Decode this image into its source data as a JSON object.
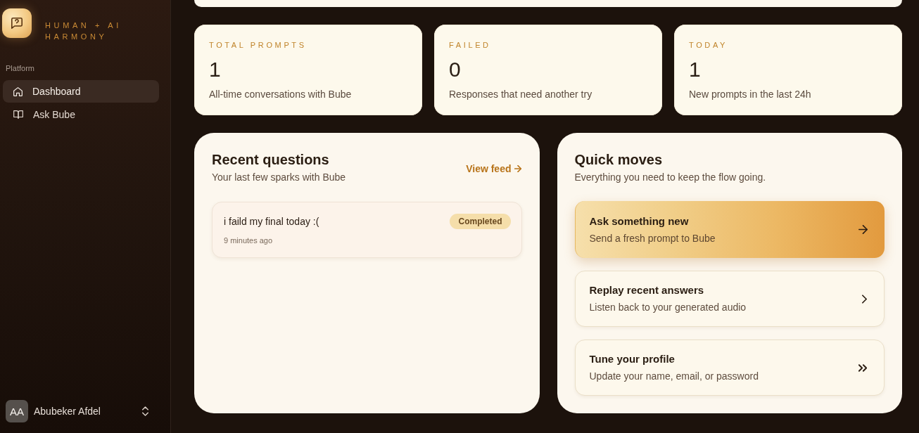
{
  "sidebar": {
    "brand": {
      "tagline": "HUMAN + AI HARMONY"
    },
    "section_label": "Platform",
    "items": [
      {
        "label": "Dashboard",
        "selected": true
      },
      {
        "label": "Ask Bube",
        "selected": false
      }
    ],
    "user": {
      "initials": "AA",
      "name": "Abubeker Afdel"
    }
  },
  "stats": [
    {
      "label": "TOTAL PROMPTS",
      "value": "1",
      "description": "All-time conversations with Bube"
    },
    {
      "label": "FAILED",
      "value": "0",
      "description": "Responses that need another try"
    },
    {
      "label": "TODAY",
      "value": "1",
      "description": "New prompts in the last 24h"
    }
  ],
  "recent_questions": {
    "title": "Recent questions",
    "subtitle": "Your last few sparks with Bube",
    "link": "View feed",
    "items": [
      {
        "text": "i faild my final today :(",
        "status": "Completed",
        "time": "9 minutes ago"
      }
    ]
  },
  "quick_moves": {
    "title": "Quick moves",
    "subtitle": "Everything you need to keep the flow going.",
    "actions": [
      {
        "kind": "primary",
        "title": "Ask something new",
        "description": "Send a fresh prompt to Bube"
      },
      {
        "kind": "secondary",
        "title": "Replay recent answers",
        "description": "Listen back to your generated audio"
      },
      {
        "kind": "secondary",
        "title": "Tune your profile",
        "description": "Update your name, email, or password"
      }
    ]
  }
}
